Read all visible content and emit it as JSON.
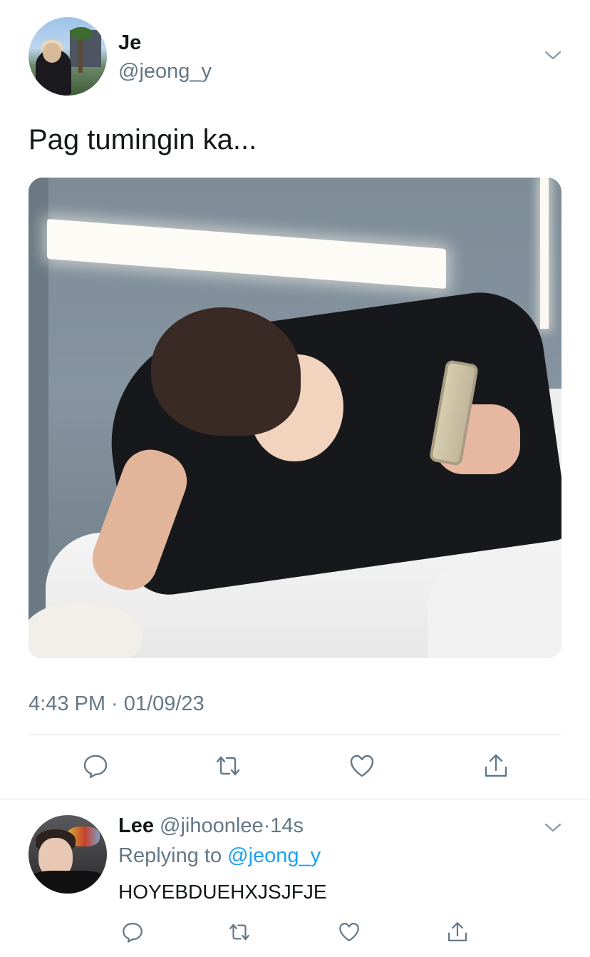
{
  "tweet": {
    "author_name": "Je",
    "author_handle": "@jeong_y",
    "text": "Pag tumingin ka...",
    "timestamp": "4:43 PM · 01/09/23",
    "actions": {
      "reply": "reply-icon",
      "retweet": "retweet-icon",
      "like": "heart-icon",
      "share": "share-icon"
    }
  },
  "reply": {
    "author_name": "Lee",
    "author_handle": "@jihoonlee",
    "separator": "·",
    "age": "14s",
    "replying_label": "Replying to",
    "replying_to": "@jeong_y",
    "text": "HOYEBDUEHXJSJFJE"
  },
  "colors": {
    "text_primary": "#14171a",
    "text_secondary": "#657786",
    "link": "#1da1f2",
    "divider": "#dde3e8"
  }
}
